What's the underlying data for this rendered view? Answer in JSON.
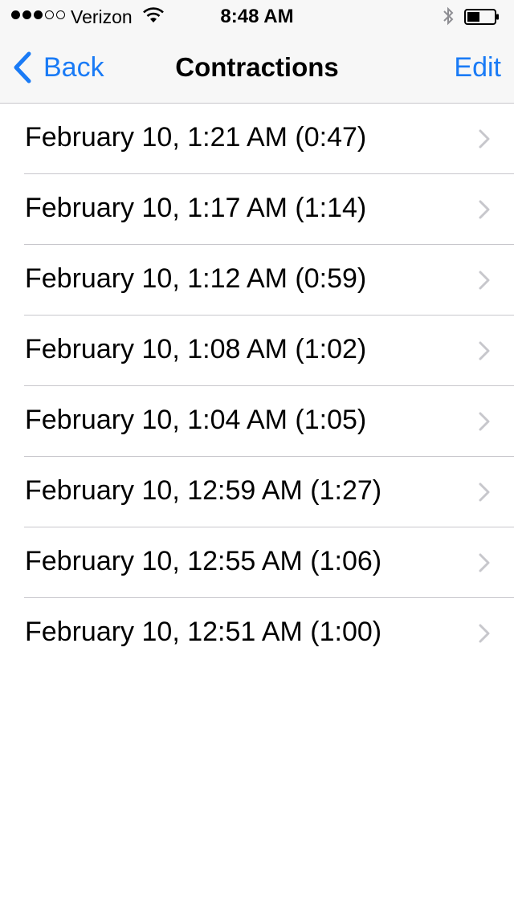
{
  "status_bar": {
    "signal_dots": [
      "full",
      "full",
      "full",
      "empty",
      "empty"
    ],
    "carrier": "Verizon",
    "time": "8:48 AM",
    "icons": [
      "wifi-icon",
      "bluetooth-icon",
      "battery-icon"
    ]
  },
  "nav": {
    "back_label": "Back",
    "title": "Contractions",
    "edit_label": "Edit",
    "accent_color": "#1a7bf6"
  },
  "contractions": [
    "February 10, 1:21 AM (0:47)",
    "February 10, 1:17 AM (1:14)",
    "February 10, 1:12 AM (0:59)",
    "February 10, 1:08 AM (1:02)",
    "February 10, 1:04 AM (1:05)",
    "February 10, 12:59 AM (1:27)",
    "February 10, 12:55 AM (1:06)",
    "February 10, 12:51 AM (1:00)"
  ]
}
